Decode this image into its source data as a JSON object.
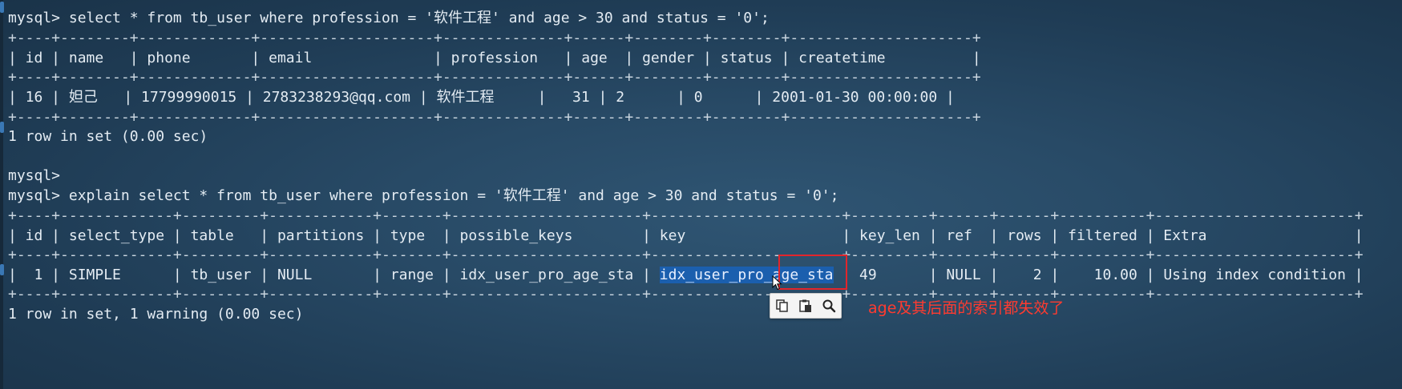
{
  "terminal": {
    "lines": [
      {
        "text": "mysql> select * from tb_user where profession = '软件工程' and age > 30 and status = '0';",
        "kind": "cmd"
      },
      {
        "text": "+----+--------+-------------+--------------------+--------------+------+--------+--------+---------------------+",
        "kind": "border"
      },
      {
        "text": "| id | name   | phone       | email              | profession   | age  | gender | status | createtime          |",
        "kind": "row"
      },
      {
        "text": "+----+--------+-------------+--------------------+--------------+------+--------+--------+---------------------+",
        "kind": "border"
      },
      {
        "text": "| 16 | 妲己   | 17799990015 | 2783238293@qq.com | 软件工程     |   31 | 2      | 0      | 2001-01-30 00:00:00 |",
        "kind": "row"
      },
      {
        "text": "+----+--------+-------------+--------------------+--------------+------+--------+--------+---------------------+",
        "kind": "border"
      },
      {
        "text": "1 row in set (0.00 sec)",
        "kind": "status"
      },
      {
        "text": "",
        "kind": "blank"
      },
      {
        "text": "mysql>",
        "kind": "cmd"
      },
      {
        "text": "mysql> explain select * from tb_user where profession = '软件工程' and age > 30 and status = '0';",
        "kind": "cmd"
      },
      {
        "text": "+----+-------------+---------+------------+-------+----------------------+----------------------+---------+------+------+----------+-----------------------+",
        "kind": "border"
      },
      {
        "text": "| id | select_type | table   | partitions | type  | possible_keys        | key                  | key_len | ref  | rows | filtered | Extra                 |",
        "kind": "row"
      },
      {
        "text": "+----+-------------+---------+------------+-------+----------------------+----------------------+---------+------+------+----------+-----------------------+",
        "kind": "border"
      },
      {
        "pre": "|  1 | SIMPLE      | tb_user | NULL       | range | idx_user_pro_age_sta | ",
        "selected": "idx_user_pro_age_sta",
        "post": " | 49      | NULL |    2 |    10.00 | Using index condition |",
        "kind": "row-selected"
      },
      {
        "text": "+----+-------------+---------+------------+-------+----------------------+----------------------+---------+------+------+----------+-----------------------+",
        "kind": "border"
      },
      {
        "text": "1 row in set, 1 warning (0.00 sec)",
        "kind": "status"
      }
    ]
  },
  "annotation": {
    "text": "age及其后面的索引都失效了",
    "color": "#ff3b30"
  },
  "selection_toolbar": {
    "buttons": [
      {
        "icon": "copy-icon",
        "label": "Copy"
      },
      {
        "icon": "paste-icon",
        "label": "Paste"
      },
      {
        "icon": "search-icon",
        "label": "Search"
      }
    ]
  },
  "colors": {
    "background": "#284a66",
    "text": "#e4ecf3",
    "selection": "#1b5fae",
    "highlight_box": "#e2252b"
  }
}
